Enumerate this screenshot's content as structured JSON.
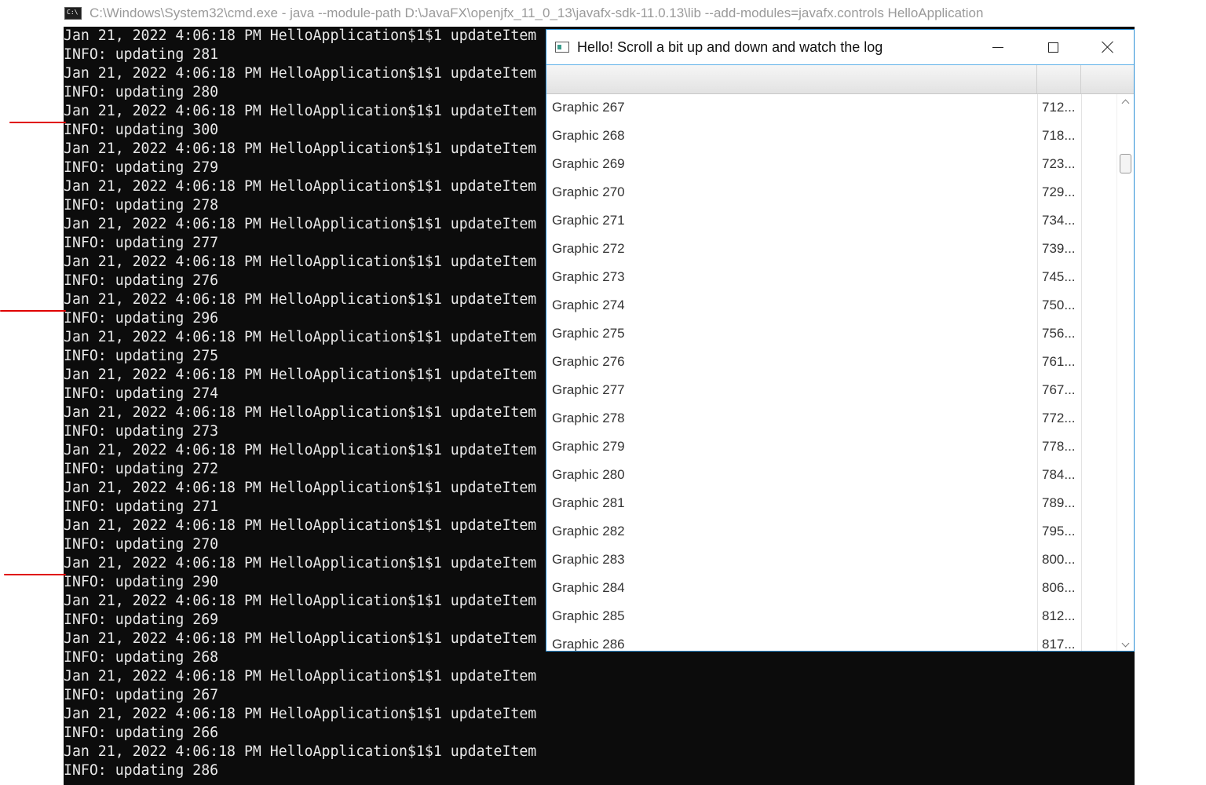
{
  "cmd": {
    "icon_label": "C:\\",
    "title": "C:\\Windows\\System32\\cmd.exe - java  --module-path D:\\JavaFX\\openjfx_11_0_13\\javafx-sdk-11.0.13\\lib --add-modules=javafx.controls HelloApplication",
    "lines": [
      "Jan 21, 2022 4:06:18 PM HelloApplication$1$1 updateItem",
      "INFO: updating 281",
      "Jan 21, 2022 4:06:18 PM HelloApplication$1$1 updateItem",
      "INFO: updating 280",
      "Jan 21, 2022 4:06:18 PM HelloApplication$1$1 updateItem",
      "INFO: updating 300",
      "Jan 21, 2022 4:06:18 PM HelloApplication$1$1 updateItem",
      "INFO: updating 279",
      "Jan 21, 2022 4:06:18 PM HelloApplication$1$1 updateItem",
      "INFO: updating 278",
      "Jan 21, 2022 4:06:18 PM HelloApplication$1$1 updateItem",
      "INFO: updating 277",
      "Jan 21, 2022 4:06:18 PM HelloApplication$1$1 updateItem",
      "INFO: updating 276",
      "Jan 21, 2022 4:06:18 PM HelloApplication$1$1 updateItem",
      "INFO: updating 296",
      "Jan 21, 2022 4:06:18 PM HelloApplication$1$1 updateItem",
      "INFO: updating 275",
      "Jan 21, 2022 4:06:18 PM HelloApplication$1$1 updateItem",
      "INFO: updating 274",
      "Jan 21, 2022 4:06:18 PM HelloApplication$1$1 updateItem",
      "INFO: updating 273",
      "Jan 21, 2022 4:06:18 PM HelloApplication$1$1 updateItem",
      "INFO: updating 272",
      "Jan 21, 2022 4:06:18 PM HelloApplication$1$1 updateItem",
      "INFO: updating 271",
      "Jan 21, 2022 4:06:18 PM HelloApplication$1$1 updateItem",
      "INFO: updating 270",
      "Jan 21, 2022 4:06:18 PM HelloApplication$1$1 updateItem",
      "INFO: updating 290",
      "Jan 21, 2022 4:06:18 PM HelloApplication$1$1 updateItem",
      "INFO: updating 269",
      "Jan 21, 2022 4:06:18 PM HelloApplication$1$1 updateItem",
      "INFO: updating 268",
      "Jan 21, 2022 4:06:18 PM HelloApplication$1$1 updateItem",
      "INFO: updating 267",
      "Jan 21, 2022 4:06:18 PM HelloApplication$1$1 updateItem",
      "INFO: updating 266",
      "Jan 21, 2022 4:06:18 PM HelloApplication$1$1 updateItem",
      "INFO: updating 286"
    ],
    "highlighted_lines": [
      "INFO: updating 300",
      "INFO: updating 296",
      "INFO: updating 290"
    ],
    "highlight_color": "#e00000"
  },
  "fx_window": {
    "title": "Hello! Scroll a bit up and down and watch the log",
    "table": {
      "columns": [
        "",
        "",
        ""
      ],
      "rows": [
        {
          "name": "Graphic 267",
          "size": "712..."
        },
        {
          "name": "Graphic 268",
          "size": "718..."
        },
        {
          "name": "Graphic 269",
          "size": "723..."
        },
        {
          "name": "Graphic 270",
          "size": "729..."
        },
        {
          "name": "Graphic 271",
          "size": "734..."
        },
        {
          "name": "Graphic 272",
          "size": "739..."
        },
        {
          "name": "Graphic 273",
          "size": "745..."
        },
        {
          "name": "Graphic 274",
          "size": "750..."
        },
        {
          "name": "Graphic 275",
          "size": "756..."
        },
        {
          "name": "Graphic 276",
          "size": "761..."
        },
        {
          "name": "Graphic 277",
          "size": "767..."
        },
        {
          "name": "Graphic 278",
          "size": "772..."
        },
        {
          "name": "Graphic 279",
          "size": "778..."
        },
        {
          "name": "Graphic 280",
          "size": "784..."
        },
        {
          "name": "Graphic 281",
          "size": "789..."
        },
        {
          "name": "Graphic 282",
          "size": "795..."
        },
        {
          "name": "Graphic 283",
          "size": "800..."
        },
        {
          "name": "Graphic 284",
          "size": "806..."
        },
        {
          "name": "Graphic 285",
          "size": "812..."
        },
        {
          "name": "Graphic 286",
          "size": "817..."
        }
      ]
    },
    "accent_color": "#2b8fd6",
    "icons": [
      "app-icon",
      "minimize-icon",
      "maximize-icon",
      "close-icon",
      "chevron-up-icon",
      "chevron-down-icon"
    ]
  }
}
